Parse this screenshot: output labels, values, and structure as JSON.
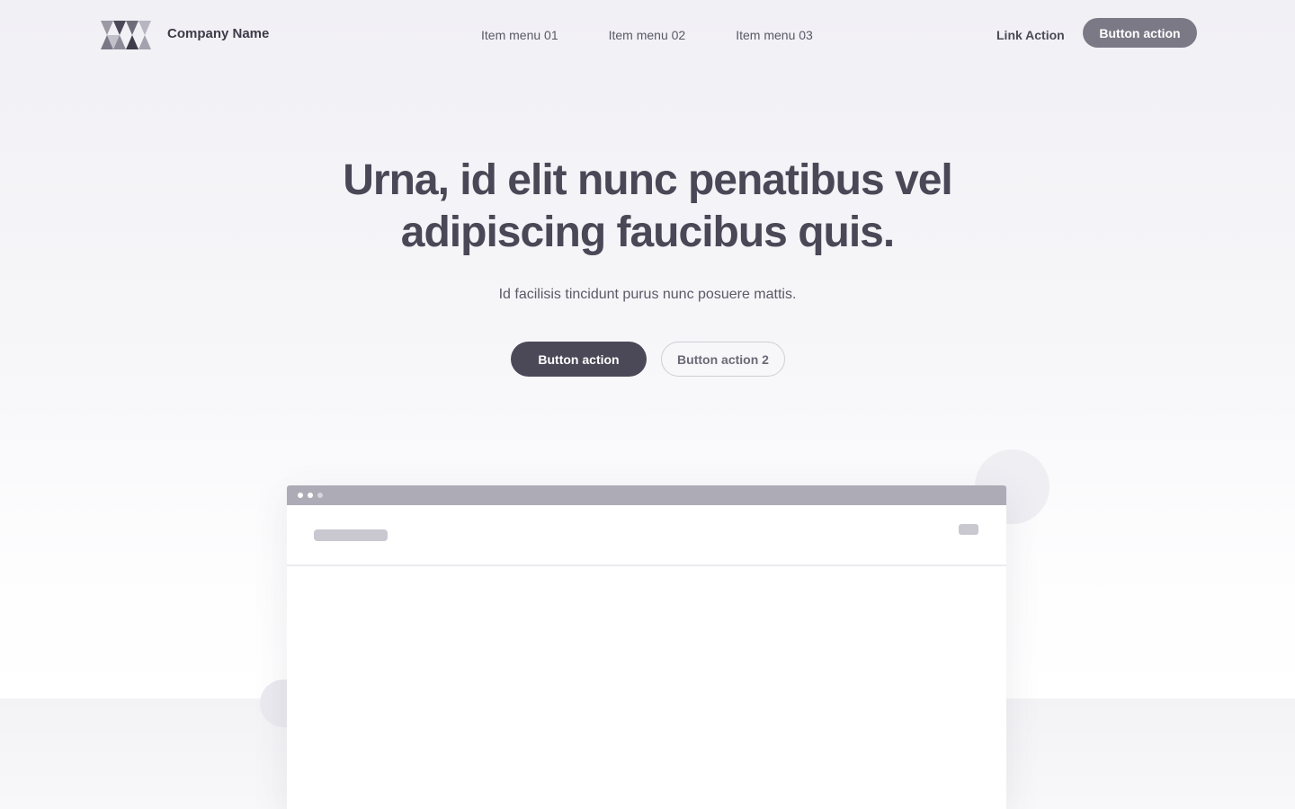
{
  "nav": {
    "company_name": "Company Name",
    "menu": [
      "Item menu 01",
      "Item menu 02",
      "Item menu 03"
    ],
    "link_action": "Link Action",
    "button_action": "Button action"
  },
  "hero": {
    "title_line1": "Urna, id elit nunc penatibus vel",
    "title_line2": "adipiscing faucibus quis.",
    "subtitle": "Id facilisis tincidunt purus nunc posuere mattis.",
    "primary_button": "Button action",
    "secondary_button": "Button action 2"
  },
  "colors": {
    "primary_dark": "#4b4957",
    "accent_gray": "#7b7986",
    "window_bar": "#acabb6"
  }
}
